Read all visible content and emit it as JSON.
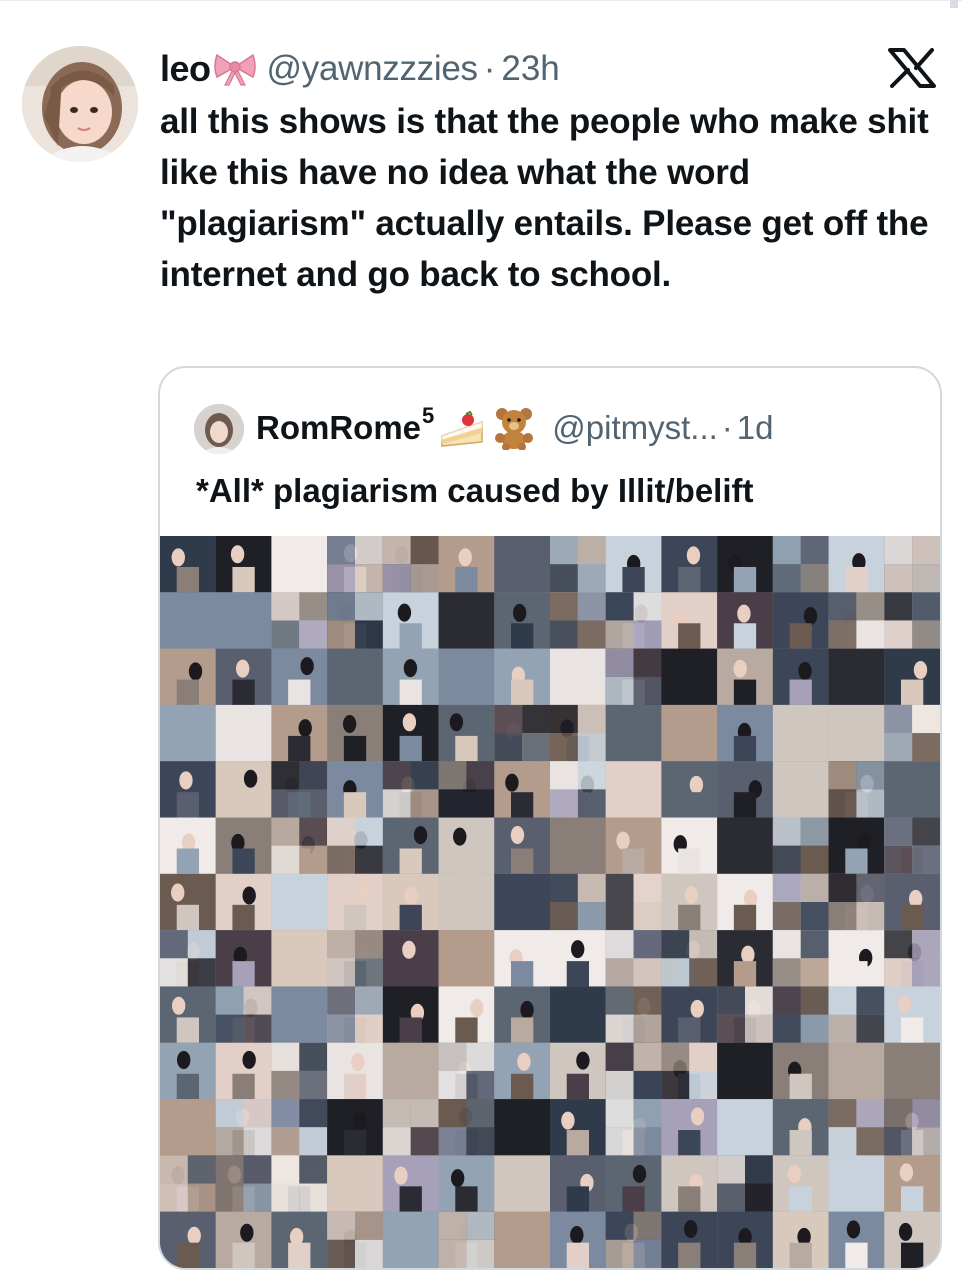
{
  "tweet": {
    "display_name": "leo",
    "handle": "@yawnzzzies",
    "separator": "·",
    "time": "23h",
    "text": "all this shows is that the people who make shit like this have no idea what the word \"plagiarism\" actually entails. Please get off the internet and go back to school.",
    "name_emoji_icon": "pink-ribbon-icon",
    "platform_icon": "x-logo-icon"
  },
  "quoted_tweet": {
    "display_name": "RomRome",
    "name_superscript": "5",
    "name_emoji_icons": [
      "shortcake-icon",
      "teddy-bear-icon"
    ],
    "handle": "@pitmyst...",
    "separator": "·",
    "time": "1d",
    "text": "*All* plagiarism caused by Illit/belift",
    "media": "photo-collage-image"
  },
  "colors": {
    "text_primary": "#0f1419",
    "text_secondary": "#536471",
    "card_border": "#cfd9de",
    "ribbon_pink": "#f2a0b8"
  }
}
